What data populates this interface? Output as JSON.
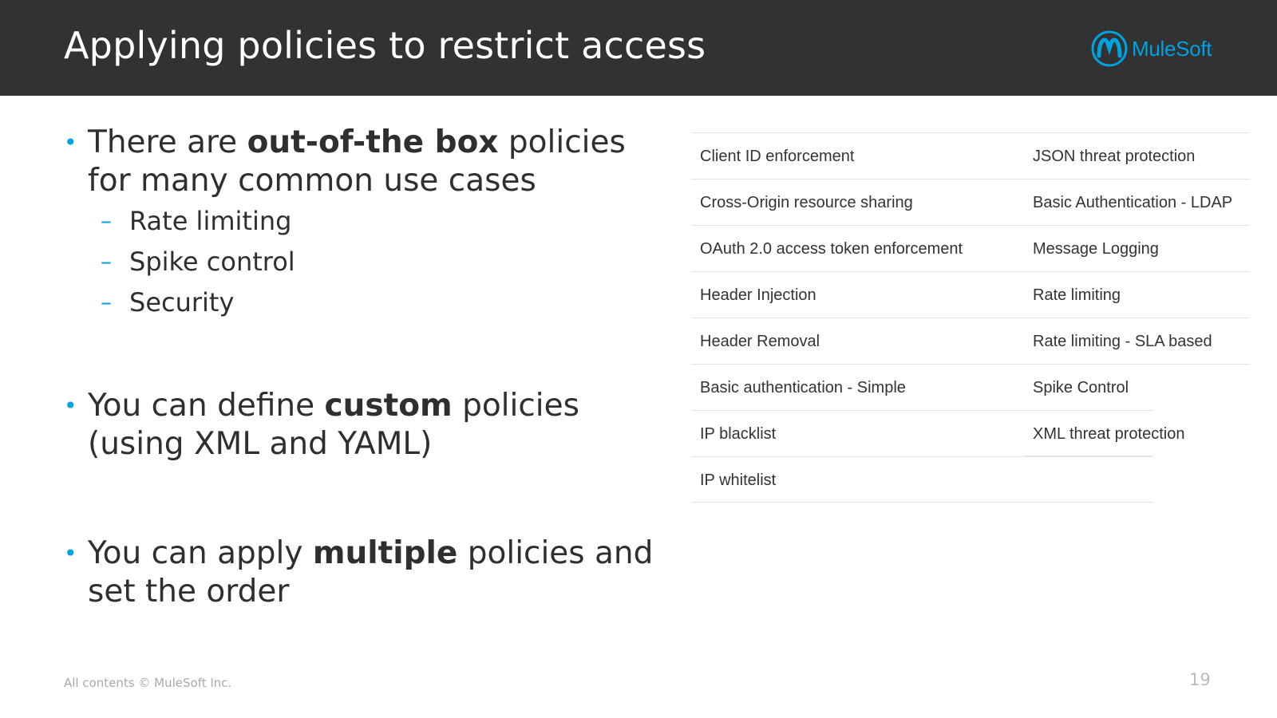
{
  "slide": {
    "title": "Applying policies to restrict access",
    "logo_text": "MuleSoft",
    "brand_color": "#00a2df",
    "header_bg": "#323232"
  },
  "bullets": {
    "b1": {
      "pre": "There are ",
      "bold": "out-of-the box",
      "post": " policies for many common use cases",
      "subs": [
        "Rate limiting",
        "Spike control",
        "Security"
      ]
    },
    "b2": {
      "pre": "You can define ",
      "bold": "custom",
      "post": " policies (using XML and YAML)"
    },
    "b3": {
      "pre": "You can apply ",
      "bold": "multiple",
      "post": " policies and set the order"
    }
  },
  "policies": {
    "left": [
      "Client ID enforcement",
      "Cross-Origin resource sharing",
      "OAuth 2.0 access token enforcement",
      "Header Injection",
      "Header Removal",
      "Basic authentication - Simple",
      "IP blacklist",
      "IP whitelist"
    ],
    "right": [
      "JSON threat protection",
      "Basic Authentication - LDAP",
      "Message Logging",
      "Rate limiting",
      "Rate limiting - SLA based",
      "Spike Control",
      "XML threat protection"
    ]
  },
  "footer": {
    "copyright": "All contents © MuleSoft Inc.",
    "page_number": "19"
  }
}
